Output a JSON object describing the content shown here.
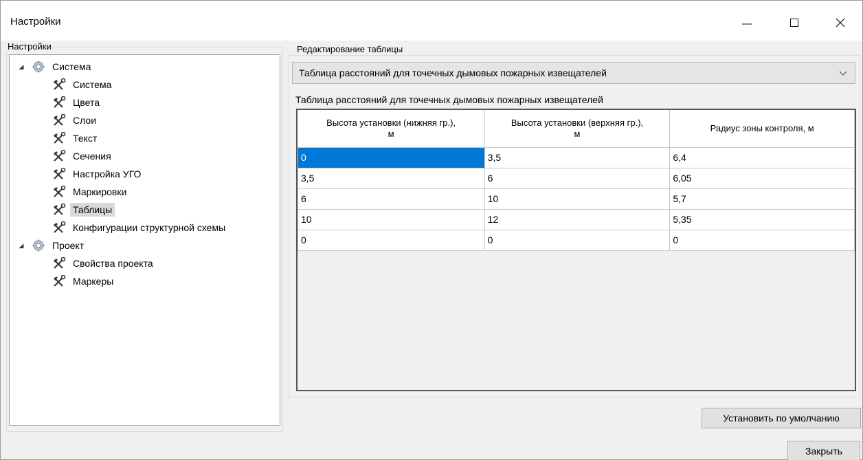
{
  "window": {
    "title": "Настройки"
  },
  "tree": {
    "group_label": "Настройки",
    "items": [
      {
        "label": "Система",
        "level": 0,
        "expanded": true,
        "icon": "gear-icon"
      },
      {
        "label": "Система",
        "level": 1,
        "icon": "tools-icon"
      },
      {
        "label": "Цвета",
        "level": 1,
        "icon": "tools-icon"
      },
      {
        "label": "Слои",
        "level": 1,
        "icon": "tools-icon"
      },
      {
        "label": "Текст",
        "level": 1,
        "icon": "tools-icon"
      },
      {
        "label": "Сечения",
        "level": 1,
        "icon": "tools-icon"
      },
      {
        "label": "Настройка УГО",
        "level": 1,
        "icon": "tools-icon"
      },
      {
        "label": "Маркировки",
        "level": 1,
        "icon": "tools-icon"
      },
      {
        "label": "Таблицы",
        "level": 1,
        "icon": "tools-icon",
        "selected": true
      },
      {
        "label": "Конфигурации структурной схемы",
        "level": 1,
        "icon": "tools-icon"
      },
      {
        "label": "Проект",
        "level": 0,
        "expanded": true,
        "icon": "gear-icon"
      },
      {
        "label": "Свойства проекта",
        "level": 1,
        "icon": "tools-icon"
      },
      {
        "label": "Маркеры",
        "level": 1,
        "icon": "tools-icon"
      }
    ]
  },
  "editor": {
    "group_label": "Редактирование таблицы",
    "selected_table": "Таблица расстояний для точечных дымовых пожарных извещателей",
    "table_caption": "Таблица расстояний для точечных дымовых пожарных извещателей",
    "columns": [
      [
        "Высота установки (нижняя гр.),",
        "м"
      ],
      [
        "Высота установки (верхняя гр.),",
        "м"
      ],
      [
        "Радиус зоны контроля, м",
        ""
      ]
    ],
    "rows": [
      [
        "0",
        "3,5",
        "6,4"
      ],
      [
        "3,5",
        "6",
        "6,05"
      ],
      [
        "6",
        "10",
        "5,7"
      ],
      [
        "10",
        "12",
        "5,35"
      ],
      [
        "0",
        "0",
        "0"
      ]
    ]
  },
  "buttons": {
    "set_default": "Установить по умолчанию",
    "close": "Закрыть"
  },
  "colors": {
    "selection": "#0078d7",
    "background": "#f0f0f0"
  }
}
